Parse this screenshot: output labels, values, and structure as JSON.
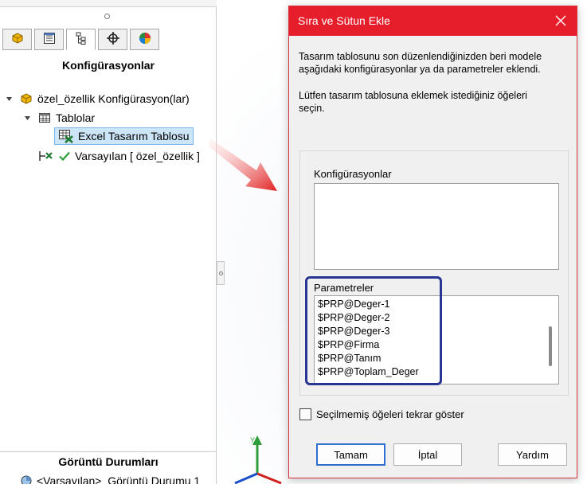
{
  "left_panel": {
    "title": "Konfigürasyonlar",
    "tabs": [
      {
        "icon": "feature-manager-icon"
      },
      {
        "icon": "property-manager-icon"
      },
      {
        "icon": "configuration-manager-icon",
        "active": true
      },
      {
        "icon": "dimxpert-icon"
      },
      {
        "icon": "display-manager-icon"
      }
    ],
    "tree": {
      "root": "özel_özellik Konfigürasyon(lar)",
      "tables_folder": "Tablolar",
      "design_table": "Excel Tasarım Tablosu",
      "default_config": "Varsayılan [ özel_özellik ]"
    },
    "display_states_title": "Görüntü Durumları",
    "display_state_item": "<Varsayılan>_Görüntü Durumu 1"
  },
  "dialog": {
    "title": "Sıra ve Sütun Ekle",
    "message_line1": "Tasarım tablosunu son düzenlendiğinizden beri modele",
    "message_line2": "aşağıdaki konfigürasyonlar ya da parametreler eklendi.",
    "instruction_line1": "Lütfen tasarım tablosuna eklemek istediğiniz öğeleri",
    "instruction_line2": "seçin.",
    "configurations_label": "Konfigürasyonlar",
    "configurations": [],
    "parameters_label": "Parametreler",
    "parameters": [
      "$PRP@Deger-1",
      "$PRP@Deger-2",
      "$PRP@Deger-3",
      "$PRP@Firma",
      "$PRP@Tanım",
      "$PRP@Toplam_Deger"
    ],
    "show_unselected_label": "Seçilmemiş öğeleri tekrar göster",
    "show_unselected_checked": false,
    "ok_label": "Tamam",
    "cancel_label": "İptal",
    "help_label": "Yardım"
  },
  "colors": {
    "titlebar": "#e61e2b",
    "highlight_box": "#283593",
    "arrow": "#e02020",
    "selection": "#cde6f7"
  }
}
